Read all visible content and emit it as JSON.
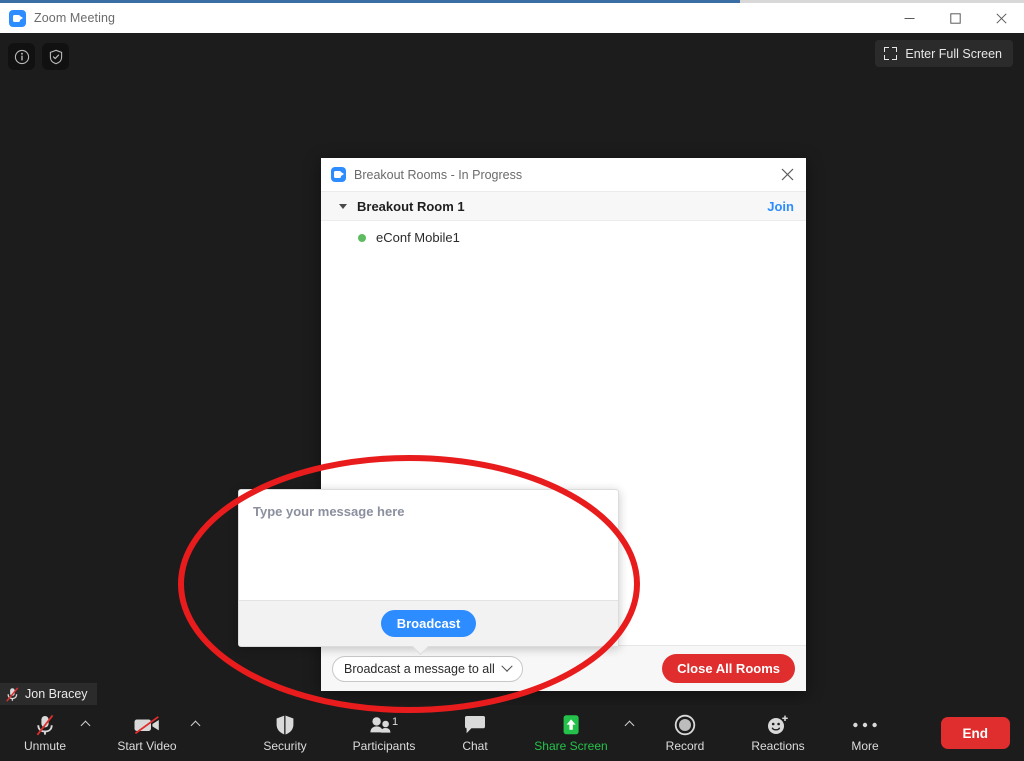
{
  "window": {
    "title": "Zoom Meeting",
    "logo_icon": "zoom-camera-icon",
    "minimize_icon": "minimize-icon",
    "maximize_icon": "maximize-icon",
    "close_icon": "close-icon"
  },
  "meeting": {
    "info_icon": "info-icon",
    "security_shield_icon": "shield-check-icon",
    "fullscreen": {
      "label": "Enter Full Screen",
      "icon": "expand-corners-icon"
    },
    "self_name": "Jon Bracey",
    "self_muted_icon": "microphone-muted-icon"
  },
  "dialog": {
    "title": "Breakout Rooms - In Progress",
    "logo_icon": "zoom-camera-icon",
    "close_icon": "close-icon",
    "room": {
      "caret_icon": "caret-down-icon",
      "name": "Breakout Room 1",
      "join_label": "Join"
    },
    "participants": [
      {
        "name": "eConf Mobile1",
        "status_icon": "status-dot-online",
        "status_color": "#5fbb5f"
      }
    ],
    "footer": {
      "dropdown_value": "Broadcast a message to all",
      "dropdown_icon": "chevron-down-icon",
      "close_all_label": "Close All Rooms",
      "close_all_color": "#e02d2d"
    }
  },
  "broadcast_popup": {
    "message_value": "",
    "message_placeholder": "Type your message here",
    "button_label": "Broadcast",
    "button_color": "#2d8cff"
  },
  "annotation": {
    "shape": "ellipse",
    "color": "#e81c1c",
    "stroke_width": 6
  },
  "toolbar": {
    "items": [
      {
        "label": "Unmute",
        "icon": "microphone-muted-icon",
        "has_arrow": true,
        "accent": false
      },
      {
        "label": "Start Video",
        "icon": "video-off-icon",
        "has_arrow": true,
        "accent": false
      },
      {
        "label": "Security",
        "icon": "shield-icon",
        "has_arrow": false,
        "accent": false
      },
      {
        "label": "Participants",
        "icon": "participants-icon",
        "has_arrow": false,
        "accent": false,
        "count": "1"
      },
      {
        "label": "Chat",
        "icon": "chat-bubble-icon",
        "has_arrow": false,
        "accent": false
      },
      {
        "label": "Share Screen",
        "icon": "share-screen-icon",
        "has_arrow": true,
        "accent": true
      },
      {
        "label": "Record",
        "icon": "record-circle-icon",
        "has_arrow": false,
        "accent": false
      },
      {
        "label": "Reactions",
        "icon": "reactions-smiley-plus-icon",
        "has_arrow": false,
        "accent": false
      },
      {
        "label": "More",
        "icon": "more-dots-icon",
        "has_arrow": false,
        "accent": false
      }
    ],
    "end_label": "End",
    "end_color": "#e02d2d",
    "accent_color": "#24c24a"
  }
}
